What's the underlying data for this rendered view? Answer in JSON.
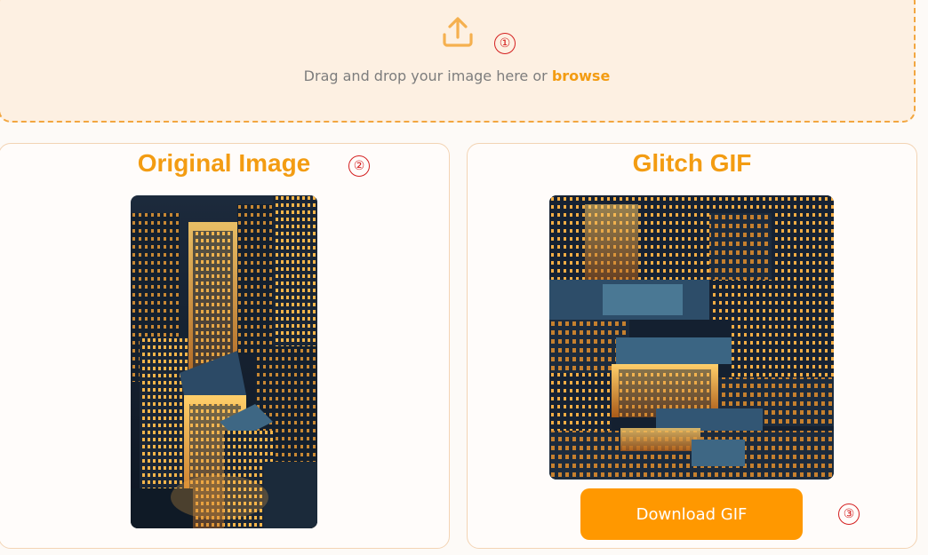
{
  "dropzone": {
    "marker": "①",
    "drop_text": "Drag and drop your image here or",
    "browse_label": "browse",
    "icon": "upload-icon"
  },
  "original_panel": {
    "title": "Original Image",
    "marker": "②"
  },
  "glitch_panel": {
    "title": "Glitch GIF",
    "download_label": "Download GIF",
    "marker": "③"
  },
  "colors": {
    "accent": "#f39c12",
    "button": "#ff9800",
    "dropzone_bg": "#fdf0e2",
    "marker": "#d42020"
  }
}
